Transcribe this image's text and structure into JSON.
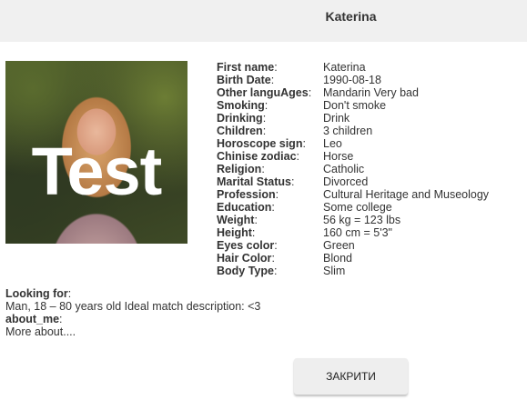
{
  "header": {
    "title": "Katerina"
  },
  "photo": {
    "watermark": "Test"
  },
  "details": [
    {
      "label": "First name",
      "value": "Katerina"
    },
    {
      "label": "Birth Date",
      "value": "1990-08-18"
    },
    {
      "label": "Other languAges",
      "value": "Mandarin Very bad"
    },
    {
      "label": "Smoking",
      "value": "Don't smoke"
    },
    {
      "label": "Drinking",
      "value": "Drink"
    },
    {
      "label": "Children",
      "value": "3 children"
    },
    {
      "label": "Horoscope sign",
      "value": "Leo"
    },
    {
      "label": "Chinise zodiac",
      "value": "Horse"
    },
    {
      "label": "Religion",
      "value": "Catholic"
    },
    {
      "label": "Marital Status",
      "value": "Divorced"
    },
    {
      "label": "Profession",
      "value": "Cultural Heritage and Museology"
    },
    {
      "label": "Education",
      "value": "Some college"
    },
    {
      "label": "Weight",
      "value": "56 kg = 123 lbs"
    },
    {
      "label": "Height",
      "value": "160 cm = 5'3\""
    },
    {
      "label": "Eyes color",
      "value": "Green"
    },
    {
      "label": "Hair Color",
      "value": "Blond"
    },
    {
      "label": "Body Type",
      "value": "Slim"
    }
  ],
  "looking_for": {
    "label": "Looking for",
    "text": "Man, 18 – 80 years old Ideal match description: <3"
  },
  "about_me": {
    "label": "about_me",
    "text": "More about...."
  },
  "close_button": {
    "label": "ЗАКРИТИ"
  }
}
